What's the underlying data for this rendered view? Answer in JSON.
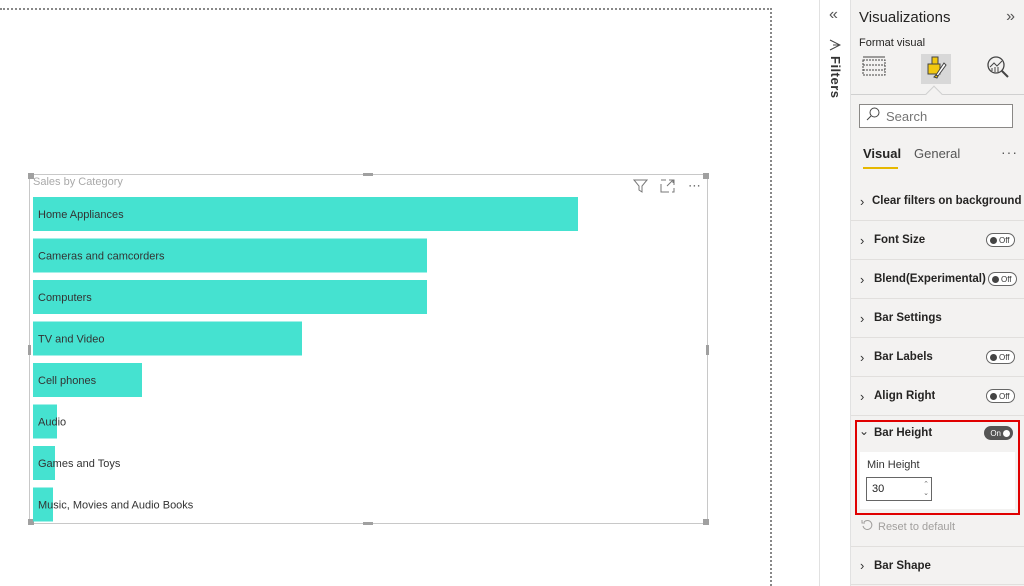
{
  "visual": {
    "title": "Sales by Category",
    "icons": [
      "filter-icon",
      "focus-mode-icon",
      "more-options-icon"
    ],
    "more_glyph": "⋯"
  },
  "chart_data": {
    "type": "bar",
    "orientation": "horizontal",
    "title": "Sales by Category",
    "xlabel": "",
    "ylabel": "",
    "categories": [
      "Home Appliances",
      "Cameras and camcorders",
      "Computers",
      "TV and Video",
      "Cell phones",
      "Audio",
      "Games and Toys",
      "Music, Movies and Audio Books"
    ],
    "values": [
      545,
      394,
      394,
      269,
      109,
      24,
      22,
      20
    ],
    "value_units": "relative (no axis shown)",
    "xlim": [
      0,
      545
    ],
    "bar_color": "#45e2d0",
    "grid": false,
    "legend": "none"
  },
  "filters": {
    "collapse_glyph": "«",
    "label": "Filters"
  },
  "visualizations": {
    "title": "Visualizations",
    "expand_glyph": "»",
    "format_label": "Format visual",
    "tabs": [
      {
        "name": "build-visual",
        "active": false
      },
      {
        "name": "format-visual",
        "active": true
      },
      {
        "name": "analytics",
        "active": false
      }
    ],
    "search_placeholder": "Search",
    "subtabs": [
      {
        "label": "Visual",
        "active": true
      },
      {
        "label": "General",
        "active": false
      }
    ],
    "more_glyph": "···",
    "sections": [
      {
        "label": "Clear filters on background click",
        "toggle": null
      },
      {
        "label": "Font Size",
        "toggle": "Off"
      },
      {
        "label": "Blend(Experimental)",
        "toggle": "Off"
      },
      {
        "label": "Bar Settings",
        "toggle": null
      },
      {
        "label": "Bar Labels",
        "toggle": "Off"
      },
      {
        "label": "Align Right",
        "toggle": "Off"
      }
    ],
    "bar_height": {
      "label": "Bar Height",
      "toggle": "On",
      "min_height_label": "Min Height",
      "min_height_value": "30",
      "reset_label": "Reset to default"
    },
    "bar_shape": {
      "label": "Bar Shape"
    },
    "chevron_right": "›",
    "chevron_down": "⌄"
  },
  "colors": {
    "accent": "#e6b800",
    "highlight_border": "#e00000",
    "bar": "#45e2d0"
  }
}
